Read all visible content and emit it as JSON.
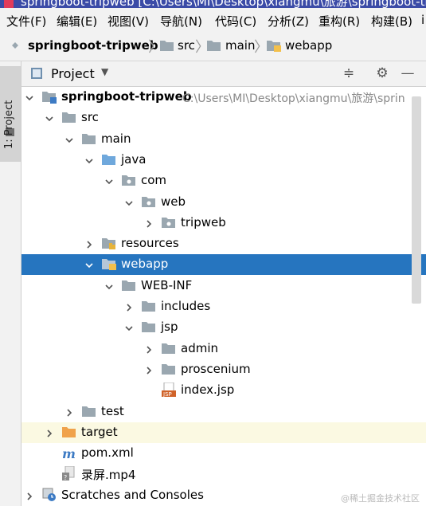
{
  "window": {
    "title": "springboot-tripweb [C:\\Users\\MI\\Desktop\\xiangmu\\旅游\\springboot-tr"
  },
  "menu": [
    "文件(F)",
    "编辑(E)",
    "视图(V)",
    "导航(N)",
    "代码(C)",
    "分析(Z)",
    "重构(R)",
    "构建(B)",
    "i"
  ],
  "breadcrumb": [
    "springboot-tripweb",
    "src",
    "main",
    "webapp"
  ],
  "left_toolbar": {
    "project_tab": "1: Project"
  },
  "project_panel": {
    "title": "Project"
  },
  "tree": [
    {
      "label": "springboot-tripweb",
      "path": "C:\\Users\\MI\\Desktop\\xiangmu\\旅游\\sprin",
      "icon": "module-folder-icon",
      "arrow": "down"
    },
    {
      "label": "src",
      "icon": "folder-icon",
      "arrow": "down"
    },
    {
      "label": "main",
      "icon": "folder-icon",
      "arrow": "down"
    },
    {
      "label": "java",
      "icon": "source-folder-icon",
      "arrow": "down"
    },
    {
      "label": "com",
      "icon": "package-icon",
      "arrow": "down"
    },
    {
      "label": "web",
      "icon": "package-icon",
      "arrow": "down"
    },
    {
      "label": "tripweb",
      "icon": "package-icon",
      "arrow": "right"
    },
    {
      "label": "resources",
      "icon": "resources-folder-icon",
      "arrow": "right"
    },
    {
      "label": "webapp",
      "icon": "web-folder-icon",
      "arrow": "down",
      "selected": true
    },
    {
      "label": "WEB-INF",
      "icon": "folder-icon",
      "arrow": "down"
    },
    {
      "label": "includes",
      "icon": "folder-icon",
      "arrow": "right"
    },
    {
      "label": "jsp",
      "icon": "folder-icon",
      "arrow": "down"
    },
    {
      "label": "admin",
      "icon": "folder-icon",
      "arrow": "right"
    },
    {
      "label": "proscenium",
      "icon": "folder-icon",
      "arrow": "right"
    },
    {
      "label": "index.jsp",
      "icon": "jsp-file-icon",
      "arrow": "none"
    },
    {
      "label": "test",
      "icon": "folder-icon",
      "arrow": "right"
    },
    {
      "label": "target",
      "icon": "excluded-folder-icon",
      "arrow": "right",
      "excluded": true
    },
    {
      "label": "pom.xml",
      "icon": "maven-file-icon",
      "arrow": "none"
    },
    {
      "label": "录屏.mp4",
      "icon": "unknown-file-icon",
      "arrow": "none"
    },
    {
      "label": "Scratches and Consoles",
      "icon": "scratches-icon",
      "arrow": "right"
    }
  ],
  "watermark": "@稀土掘金技术社区",
  "colors": {
    "selection": "#2675bf",
    "folder": "#9aa7b0",
    "source_folder": "#6fa8dc",
    "excluded": "#f0a24b",
    "excluded_row": "#fbf9e2"
  }
}
